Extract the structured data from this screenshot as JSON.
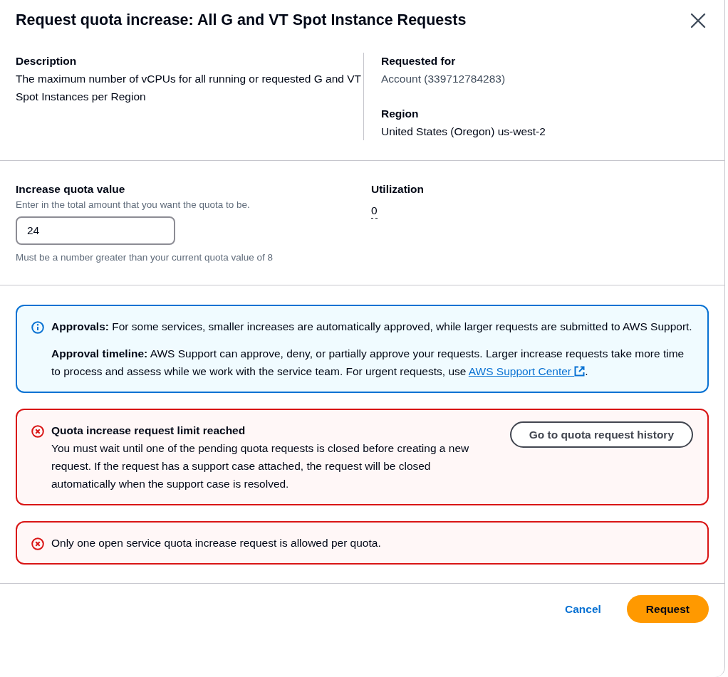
{
  "dialog": {
    "title": "Request quota increase: All G and VT Spot Instance Requests"
  },
  "details": {
    "description": {
      "label": "Description",
      "value": "The maximum number of vCPUs for all running or requested G and VT Spot Instances per Region"
    },
    "requested_for": {
      "label": "Requested for",
      "value": "Account (339712784283)"
    },
    "region": {
      "label": "Region",
      "value": "United States (Oregon) us-west-2"
    }
  },
  "quota_field": {
    "label": "Increase quota value",
    "hint": "Enter in the total amount that you want the quota to be.",
    "value": "24",
    "constraint": "Must be a number greater than your current quota value of 8"
  },
  "utilization": {
    "label": "Utilization",
    "value": "0"
  },
  "alerts": [
    {
      "kind": "info",
      "paragraphs": [
        {
          "text": "**Approvals:** For some services, smaller increases are automatically approved, while larger requests are submitted to AWS Support."
        },
        {
          "text": "**Approval timeline:** AWS Support can approve, deny, or partially approve your requests. Larger increase requests take more time to process and assess while we work with the service team. For urgent requests, use",
          "link": "AWS Support Center",
          "after": "."
        }
      ]
    },
    {
      "kind": "error",
      "title": "Quota increase request limit reached",
      "text": "You must wait until one of the pending quota requests is closed before creating a new request. If the request has a support case attached, the request will be closed automatically when the support case is resolved.",
      "action": "Go to quota request history"
    },
    {
      "kind": "error",
      "text": "Only one open service quota increase request is allowed per quota."
    }
  ],
  "footer": {
    "cancel": "Cancel",
    "submit": "Request"
  }
}
